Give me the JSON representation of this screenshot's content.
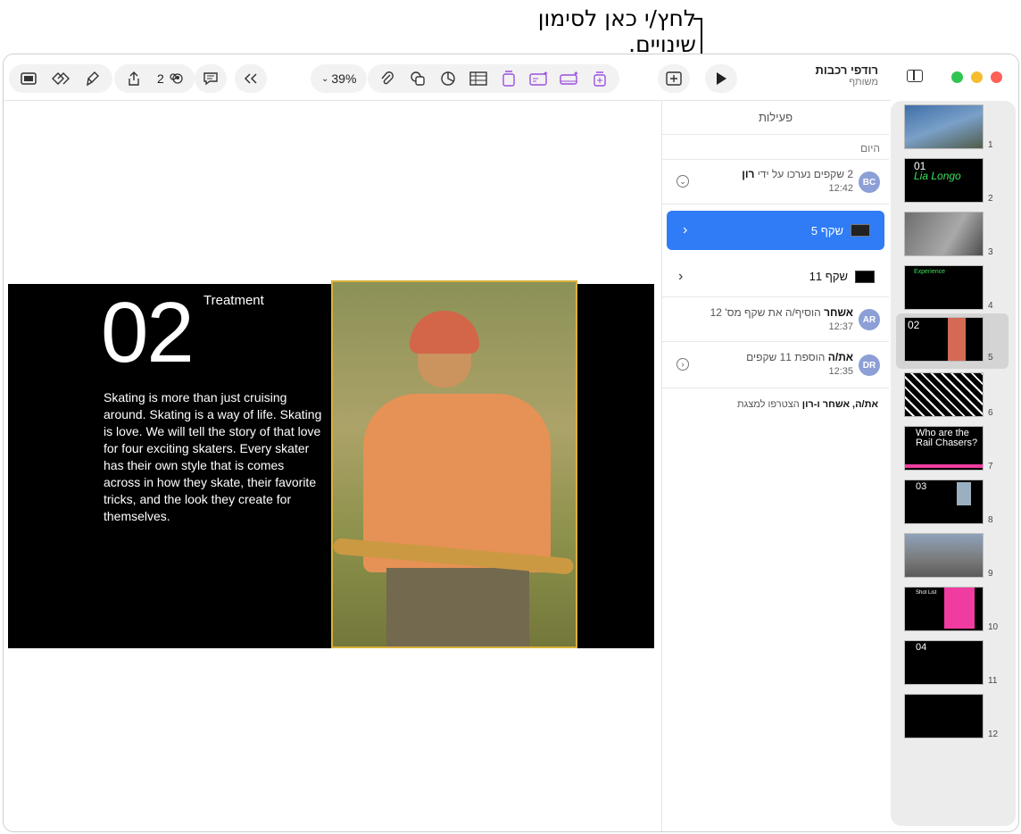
{
  "callout": {
    "text": "לחץ/י כאן לסימון שינויים."
  },
  "toolbar": {
    "collab_count": "2",
    "zoom": "39%",
    "doc_title": "רודפי רכבות",
    "doc_subtitle": "משותף"
  },
  "slide": {
    "number": "02",
    "heading": "Treatment",
    "body": "Skating is more than just cruising around. Skating is a way of life. Skating is love. We will tell the story of that love for four exciting skaters. Every skater has their own style that is comes across in how they skate, their favorite tricks, and the look they create for themselves."
  },
  "activity": {
    "header": "פעילות",
    "today": "היום",
    "rows": [
      {
        "avatar": "BC",
        "text_prefix": "2 שקפים נערכו על ידי ",
        "text_name": "רון",
        "time": "12:42"
      },
      {
        "avatar": "AR",
        "text_name": "אשחר",
        "text_suffix": " הוסיף/ה את שקף מס' 12",
        "time": "12:37"
      },
      {
        "avatar": "DR",
        "text_name": "את/ה",
        "text_suffix": " הוספת 11 שקפים",
        "time": "12:35"
      }
    ],
    "slide5": "שקף 5",
    "slide11": "שקף 11",
    "footer_names": "את/ה, אשחר ו-רון",
    "footer_suffix": " הצטרפו למצגת"
  },
  "navigator": {
    "slides": [
      {
        "num": "1"
      },
      {
        "num": "2",
        "title": "01",
        "subtitle": "Lia Longo"
      },
      {
        "num": "3"
      },
      {
        "num": "4",
        "title": "Experience"
      },
      {
        "num": "5",
        "title": "02"
      },
      {
        "num": "6"
      },
      {
        "num": "7",
        "title": "Who are the Rail Chasers?"
      },
      {
        "num": "8",
        "title": "03"
      },
      {
        "num": "9"
      },
      {
        "num": "10",
        "title": "Shot List"
      },
      {
        "num": "11",
        "title": "04"
      },
      {
        "num": "12"
      }
    ]
  },
  "colors": {
    "accent": "#2f7cf6",
    "selection": "#d9b13a",
    "purple": "#9b4fe0"
  }
}
